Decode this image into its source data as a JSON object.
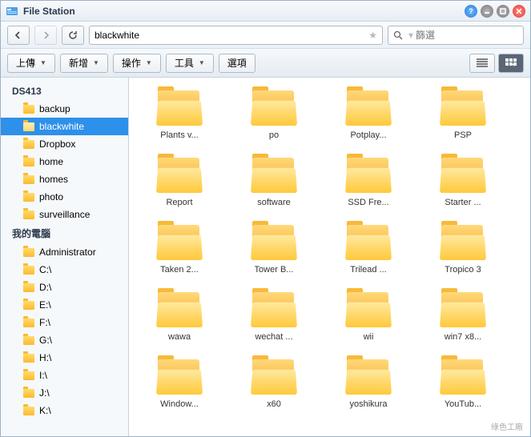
{
  "window": {
    "title": "File Station"
  },
  "nav": {
    "path_value": "blackwhite",
    "search_placeholder": "篩選"
  },
  "toolbar": {
    "upload": "上傳",
    "create": "新增",
    "action": "操作",
    "tools": "工具",
    "options": "選項"
  },
  "sidebar": {
    "roots": [
      {
        "label": "DS413",
        "children": [
          {
            "label": "backup"
          },
          {
            "label": "blackwhite",
            "selected": true
          },
          {
            "label": "Dropbox"
          },
          {
            "label": "home"
          },
          {
            "label": "homes"
          },
          {
            "label": "photo"
          },
          {
            "label": "surveillance"
          }
        ]
      },
      {
        "label": "我的電腦",
        "children": [
          {
            "label": "Administrator"
          },
          {
            "label": "C:\\"
          },
          {
            "label": "D:\\"
          },
          {
            "label": "E:\\"
          },
          {
            "label": "F:\\"
          },
          {
            "label": "G:\\"
          },
          {
            "label": "H:\\"
          },
          {
            "label": "I:\\"
          },
          {
            "label": "J:\\"
          },
          {
            "label": "K:\\"
          }
        ]
      }
    ]
  },
  "folders": [
    {
      "label": "Plants v..."
    },
    {
      "label": "po"
    },
    {
      "label": "Potplay..."
    },
    {
      "label": "PSP"
    },
    {
      "label": "Report"
    },
    {
      "label": "software"
    },
    {
      "label": "SSD Fre..."
    },
    {
      "label": "Starter ..."
    },
    {
      "label": "Taken 2..."
    },
    {
      "label": "Tower B..."
    },
    {
      "label": "Trilead ..."
    },
    {
      "label": "Tropico 3"
    },
    {
      "label": "wawa"
    },
    {
      "label": "wechat ..."
    },
    {
      "label": "wii"
    },
    {
      "label": "win7 x8..."
    },
    {
      "label": "Window..."
    },
    {
      "label": "x60"
    },
    {
      "label": "yoshikura"
    },
    {
      "label": "YouTub..."
    }
  ],
  "watermark": "綠色工廠"
}
